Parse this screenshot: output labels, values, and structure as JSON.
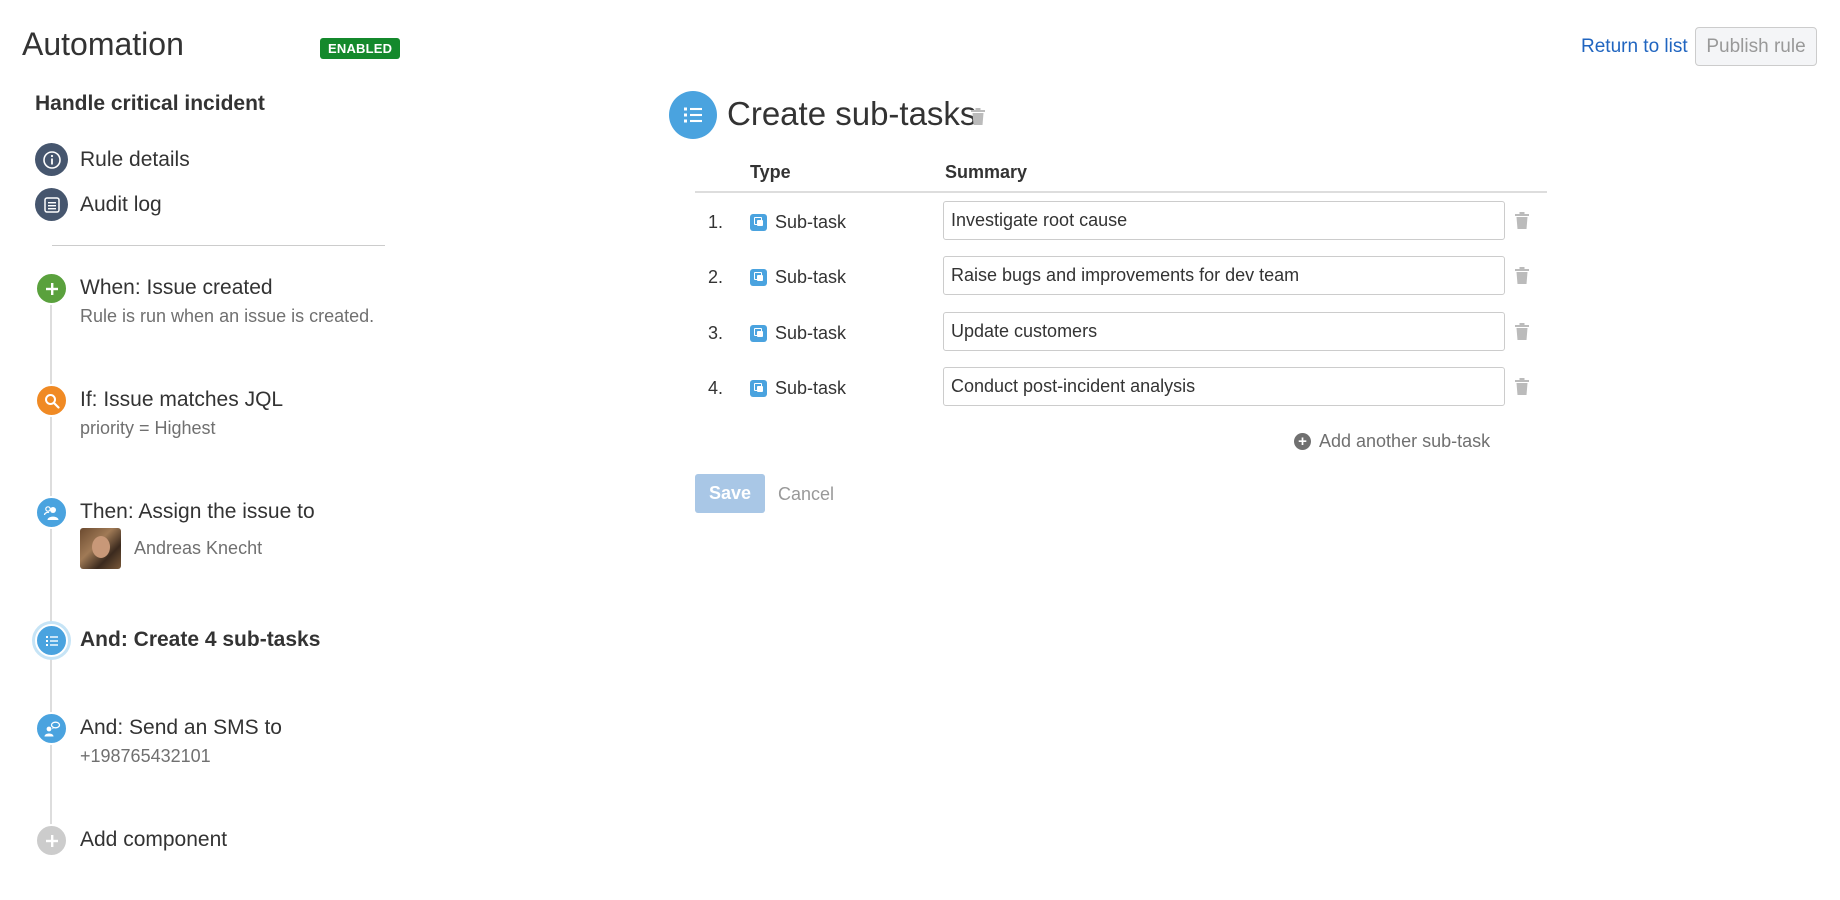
{
  "header": {
    "app_title": "Automation",
    "status_badge": "ENABLED",
    "return_link": "Return to list",
    "publish_button": "Publish rule"
  },
  "sidebar": {
    "rule_name": "Handle critical incident",
    "links": [
      {
        "label": "Rule details",
        "icon": "info-icon"
      },
      {
        "label": "Audit log",
        "icon": "list-icon"
      }
    ],
    "steps": [
      {
        "title": "When: Issue created",
        "subtitle": "Rule is run when an issue is created.",
        "icon": "plus-icon",
        "color": "#5aa13d"
      },
      {
        "title": "If: Issue matches JQL",
        "subtitle": "priority = Highest",
        "icon": "search-icon",
        "color": "#f08a24"
      },
      {
        "title": "Then: Assign the issue to",
        "assignee": "Andreas Knecht",
        "icon": "assign-user-icon",
        "color": "#4aa3df"
      },
      {
        "title": "And: Create 4 sub-tasks",
        "icon": "list-icon",
        "color": "#4aa3df",
        "active": true
      },
      {
        "title": "And: Send an SMS to",
        "subtitle": "+198765432101",
        "icon": "sms-user-icon",
        "color": "#4aa3df"
      },
      {
        "title": "Add component",
        "icon": "plus-icon",
        "color": "#cccccc"
      }
    ]
  },
  "main": {
    "title": "Create sub-tasks",
    "columns": {
      "type": "Type",
      "summary": "Summary"
    },
    "rows": [
      {
        "num": "1.",
        "type": "Sub-task",
        "summary": "Investigate root cause"
      },
      {
        "num": "2.",
        "type": "Sub-task",
        "summary": "Raise bugs and improvements for dev team"
      },
      {
        "num": "3.",
        "type": "Sub-task",
        "summary": "Update customers"
      },
      {
        "num": "4.",
        "type": "Sub-task",
        "summary": "Conduct post-incident analysis"
      }
    ],
    "add_label": "Add another sub-task",
    "save_label": "Save",
    "cancel_label": "Cancel"
  },
  "colors": {
    "accent_blue": "#4aa3df",
    "link_blue": "#2065c0",
    "badge_green": "#14892c",
    "sidebar_icon": "#46566e"
  }
}
